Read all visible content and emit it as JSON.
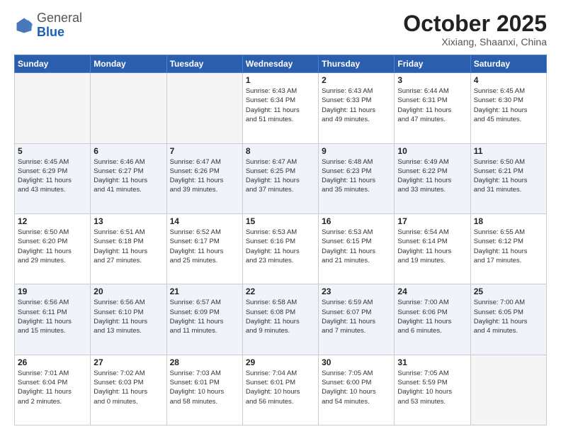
{
  "header": {
    "logo_general": "General",
    "logo_blue": "Blue",
    "month": "October 2025",
    "location": "Xixiang, Shaanxi, China"
  },
  "days_of_week": [
    "Sunday",
    "Monday",
    "Tuesday",
    "Wednesday",
    "Thursday",
    "Friday",
    "Saturday"
  ],
  "weeks": [
    [
      {
        "day": "",
        "info": ""
      },
      {
        "day": "",
        "info": ""
      },
      {
        "day": "",
        "info": ""
      },
      {
        "day": "1",
        "info": "Sunrise: 6:43 AM\nSunset: 6:34 PM\nDaylight: 11 hours\nand 51 minutes."
      },
      {
        "day": "2",
        "info": "Sunrise: 6:43 AM\nSunset: 6:33 PM\nDaylight: 11 hours\nand 49 minutes."
      },
      {
        "day": "3",
        "info": "Sunrise: 6:44 AM\nSunset: 6:31 PM\nDaylight: 11 hours\nand 47 minutes."
      },
      {
        "day": "4",
        "info": "Sunrise: 6:45 AM\nSunset: 6:30 PM\nDaylight: 11 hours\nand 45 minutes."
      }
    ],
    [
      {
        "day": "5",
        "info": "Sunrise: 6:45 AM\nSunset: 6:29 PM\nDaylight: 11 hours\nand 43 minutes."
      },
      {
        "day": "6",
        "info": "Sunrise: 6:46 AM\nSunset: 6:27 PM\nDaylight: 11 hours\nand 41 minutes."
      },
      {
        "day": "7",
        "info": "Sunrise: 6:47 AM\nSunset: 6:26 PM\nDaylight: 11 hours\nand 39 minutes."
      },
      {
        "day": "8",
        "info": "Sunrise: 6:47 AM\nSunset: 6:25 PM\nDaylight: 11 hours\nand 37 minutes."
      },
      {
        "day": "9",
        "info": "Sunrise: 6:48 AM\nSunset: 6:23 PM\nDaylight: 11 hours\nand 35 minutes."
      },
      {
        "day": "10",
        "info": "Sunrise: 6:49 AM\nSunset: 6:22 PM\nDaylight: 11 hours\nand 33 minutes."
      },
      {
        "day": "11",
        "info": "Sunrise: 6:50 AM\nSunset: 6:21 PM\nDaylight: 11 hours\nand 31 minutes."
      }
    ],
    [
      {
        "day": "12",
        "info": "Sunrise: 6:50 AM\nSunset: 6:20 PM\nDaylight: 11 hours\nand 29 minutes."
      },
      {
        "day": "13",
        "info": "Sunrise: 6:51 AM\nSunset: 6:18 PM\nDaylight: 11 hours\nand 27 minutes."
      },
      {
        "day": "14",
        "info": "Sunrise: 6:52 AM\nSunset: 6:17 PM\nDaylight: 11 hours\nand 25 minutes."
      },
      {
        "day": "15",
        "info": "Sunrise: 6:53 AM\nSunset: 6:16 PM\nDaylight: 11 hours\nand 23 minutes."
      },
      {
        "day": "16",
        "info": "Sunrise: 6:53 AM\nSunset: 6:15 PM\nDaylight: 11 hours\nand 21 minutes."
      },
      {
        "day": "17",
        "info": "Sunrise: 6:54 AM\nSunset: 6:14 PM\nDaylight: 11 hours\nand 19 minutes."
      },
      {
        "day": "18",
        "info": "Sunrise: 6:55 AM\nSunset: 6:12 PM\nDaylight: 11 hours\nand 17 minutes."
      }
    ],
    [
      {
        "day": "19",
        "info": "Sunrise: 6:56 AM\nSunset: 6:11 PM\nDaylight: 11 hours\nand 15 minutes."
      },
      {
        "day": "20",
        "info": "Sunrise: 6:56 AM\nSunset: 6:10 PM\nDaylight: 11 hours\nand 13 minutes."
      },
      {
        "day": "21",
        "info": "Sunrise: 6:57 AM\nSunset: 6:09 PM\nDaylight: 11 hours\nand 11 minutes."
      },
      {
        "day": "22",
        "info": "Sunrise: 6:58 AM\nSunset: 6:08 PM\nDaylight: 11 hours\nand 9 minutes."
      },
      {
        "day": "23",
        "info": "Sunrise: 6:59 AM\nSunset: 6:07 PM\nDaylight: 11 hours\nand 7 minutes."
      },
      {
        "day": "24",
        "info": "Sunrise: 7:00 AM\nSunset: 6:06 PM\nDaylight: 11 hours\nand 6 minutes."
      },
      {
        "day": "25",
        "info": "Sunrise: 7:00 AM\nSunset: 6:05 PM\nDaylight: 11 hours\nand 4 minutes."
      }
    ],
    [
      {
        "day": "26",
        "info": "Sunrise: 7:01 AM\nSunset: 6:04 PM\nDaylight: 11 hours\nand 2 minutes."
      },
      {
        "day": "27",
        "info": "Sunrise: 7:02 AM\nSunset: 6:03 PM\nDaylight: 11 hours\nand 0 minutes."
      },
      {
        "day": "28",
        "info": "Sunrise: 7:03 AM\nSunset: 6:01 PM\nDaylight: 10 hours\nand 58 minutes."
      },
      {
        "day": "29",
        "info": "Sunrise: 7:04 AM\nSunset: 6:01 PM\nDaylight: 10 hours\nand 56 minutes."
      },
      {
        "day": "30",
        "info": "Sunrise: 7:05 AM\nSunset: 6:00 PM\nDaylight: 10 hours\nand 54 minutes."
      },
      {
        "day": "31",
        "info": "Sunrise: 7:05 AM\nSunset: 5:59 PM\nDaylight: 10 hours\nand 53 minutes."
      },
      {
        "day": "",
        "info": ""
      }
    ]
  ]
}
